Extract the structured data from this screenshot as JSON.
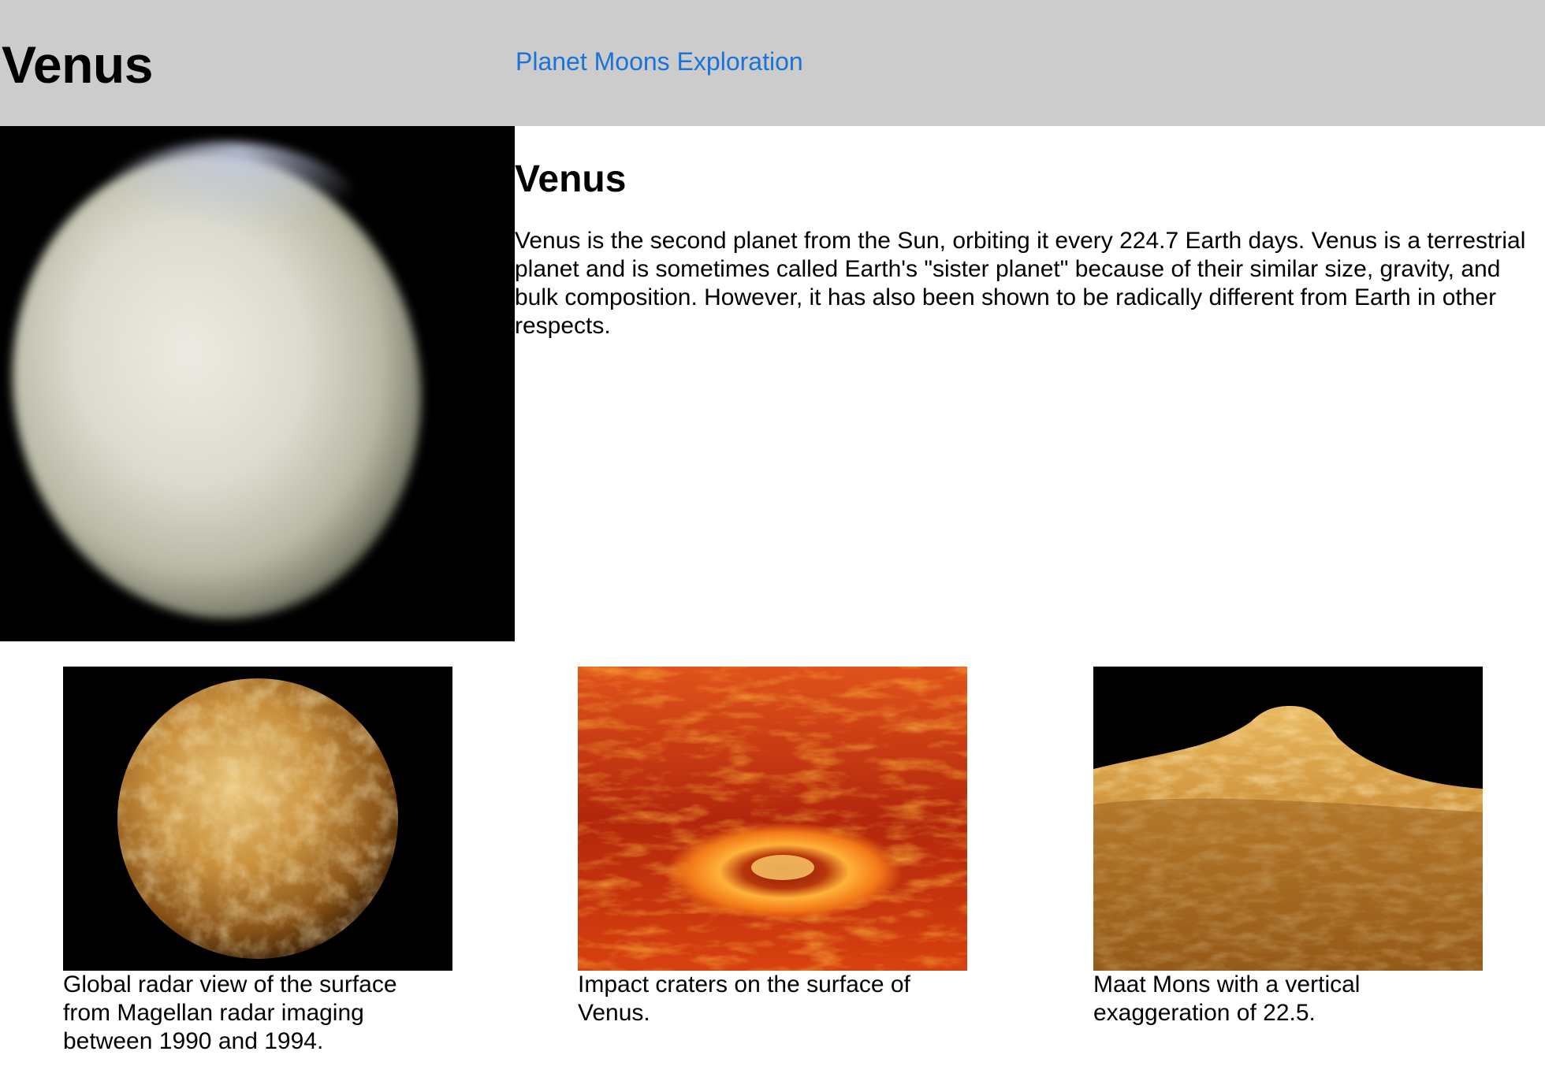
{
  "header": {
    "title": "Venus",
    "nav_link": "Planet Moons Exploration"
  },
  "article": {
    "heading": "Venus",
    "body": "Venus is the second planet from the Sun, orbiting it every 224.7 Earth days. Venus is a terrestrial planet and is sometimes called Earth's \"sister planet\" because of their similar size, gravity, and bulk composition. However, it has also been shown to be radically different from Earth in other respects."
  },
  "gallery": [
    {
      "caption": "Global radar view of the surface from Magellan radar imaging between 1990 and 1994."
    },
    {
      "caption": "Impact craters on the surface of Venus."
    },
    {
      "caption": "Maat Mons with a vertical exaggeration of 22.5."
    }
  ],
  "colors": {
    "header_bg": "#cccccc",
    "link": "#1a73d8"
  }
}
